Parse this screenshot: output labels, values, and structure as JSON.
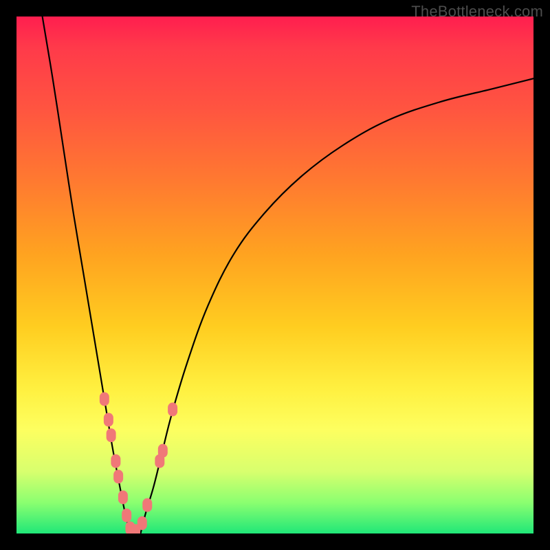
{
  "watermark": "TheBottleneck.com",
  "colors": {
    "frame": "#000000",
    "gradient_top": "#ff1e4f",
    "gradient_bottom": "#20e778",
    "marker": "#f07878",
    "curve": "#000000"
  },
  "chart_data": {
    "type": "line",
    "title": "",
    "xlabel": "",
    "ylabel": "",
    "xlim": [
      0,
      100
    ],
    "ylim": [
      0,
      100
    ],
    "series": [
      {
        "name": "left-branch",
        "x": [
          5,
          7,
          9,
          11,
          13,
          15,
          17,
          18.5,
          20,
          21,
          22
        ],
        "y": [
          100,
          88,
          75,
          62,
          50,
          38,
          26,
          17,
          9,
          4,
          0
        ]
      },
      {
        "name": "right-branch",
        "x": [
          24,
          25,
          26.5,
          28,
          30,
          33,
          37,
          42,
          48,
          55,
          63,
          72,
          82,
          92,
          100
        ],
        "y": [
          0,
          4,
          9,
          15,
          23,
          33,
          44,
          54,
          62,
          69,
          75,
          80,
          83.5,
          86,
          88
        ]
      }
    ],
    "markers": [
      {
        "x": 17.0,
        "y": 26
      },
      {
        "x": 17.8,
        "y": 22
      },
      {
        "x": 18.3,
        "y": 19
      },
      {
        "x": 19.2,
        "y": 14
      },
      {
        "x": 19.7,
        "y": 11
      },
      {
        "x": 20.6,
        "y": 7
      },
      {
        "x": 21.3,
        "y": 3.5
      },
      {
        "x": 22.0,
        "y": 1
      },
      {
        "x": 23.0,
        "y": 0.5
      },
      {
        "x": 24.3,
        "y": 2
      },
      {
        "x": 25.3,
        "y": 5.5
      },
      {
        "x": 27.7,
        "y": 14
      },
      {
        "x": 28.3,
        "y": 16
      },
      {
        "x": 30.2,
        "y": 24
      }
    ],
    "marker_shape": "rounded-rect"
  }
}
